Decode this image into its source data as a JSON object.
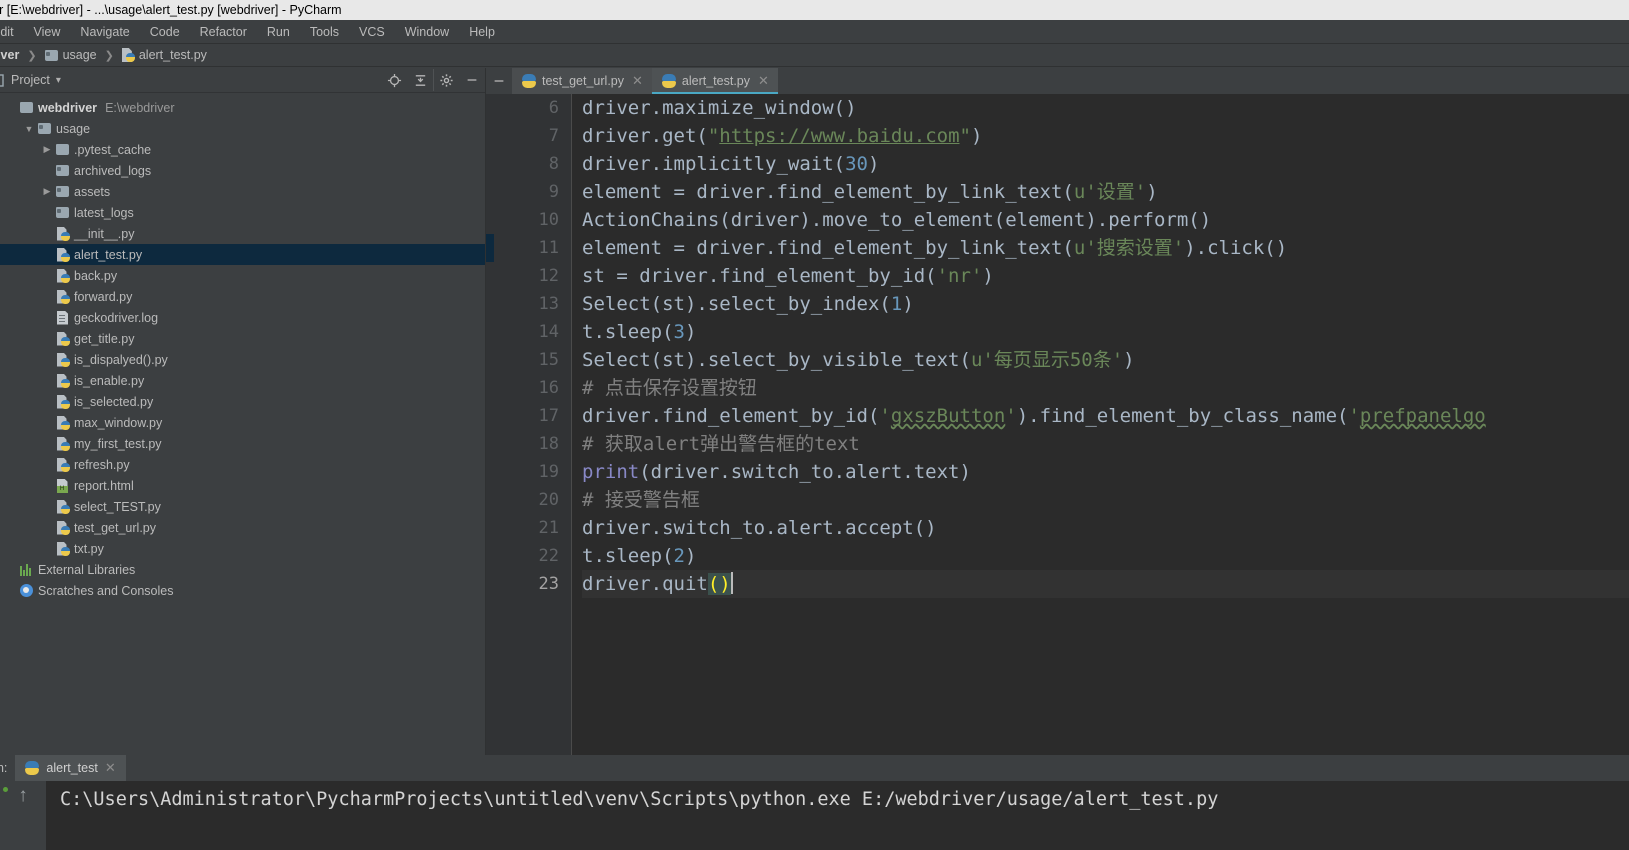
{
  "window": {
    "title": "driver [E:\\webdriver] - ...\\usage\\alert_test.py [webdriver] - PyCharm"
  },
  "menubar": {
    "items": [
      "Edit",
      "View",
      "Navigate",
      "Code",
      "Refactor",
      "Run",
      "Tools",
      "VCS",
      "Window",
      "Help"
    ]
  },
  "breadcrumb": {
    "items": [
      "ebdriver",
      "usage",
      "alert_test.py"
    ]
  },
  "project_panel": {
    "title": "Project",
    "chevron": "▾",
    "tools": [
      "locate-icon",
      "collapse-all-icon",
      "settings-icon",
      "hide-icon"
    ],
    "tree": [
      {
        "label": "webdriver",
        "sub": "E:\\webdriver",
        "icon": "folder-icon",
        "arrow": "",
        "indent": 0,
        "selected": false,
        "root": true
      },
      {
        "label": "usage",
        "sub": "",
        "icon": "module-folder-icon",
        "arrow": "▼",
        "indent": 1,
        "selected": false,
        "root": false
      },
      {
        "label": ".pytest_cache",
        "sub": "",
        "icon": "folder-icon",
        "arrow": "▶",
        "indent": 2,
        "selected": false,
        "root": false
      },
      {
        "label": "archived_logs",
        "sub": "",
        "icon": "module-folder-icon",
        "arrow": "",
        "indent": 2,
        "selected": false,
        "root": false
      },
      {
        "label": "assets",
        "sub": "",
        "icon": "module-folder-icon",
        "arrow": "▶",
        "indent": 2,
        "selected": false,
        "root": false
      },
      {
        "label": "latest_logs",
        "sub": "",
        "icon": "module-folder-icon",
        "arrow": "",
        "indent": 2,
        "selected": false,
        "root": false
      },
      {
        "label": "__init__.py",
        "sub": "",
        "icon": "python-file-icon",
        "arrow": "",
        "indent": 2,
        "selected": false,
        "root": false
      },
      {
        "label": "alert_test.py",
        "sub": "",
        "icon": "python-file-icon",
        "arrow": "",
        "indent": 2,
        "selected": true,
        "root": false
      },
      {
        "label": "back.py",
        "sub": "",
        "icon": "python-file-icon",
        "arrow": "",
        "indent": 2,
        "selected": false,
        "root": false
      },
      {
        "label": "forward.py",
        "sub": "",
        "icon": "python-file-icon",
        "arrow": "",
        "indent": 2,
        "selected": false,
        "root": false
      },
      {
        "label": "geckodriver.log",
        "sub": "",
        "icon": "log-file-icon",
        "arrow": "",
        "indent": 2,
        "selected": false,
        "root": false
      },
      {
        "label": "get_title.py",
        "sub": "",
        "icon": "python-file-icon",
        "arrow": "",
        "indent": 2,
        "selected": false,
        "root": false
      },
      {
        "label": "is_dispalyed().py",
        "sub": "",
        "icon": "python-file-icon",
        "arrow": "",
        "indent": 2,
        "selected": false,
        "root": false
      },
      {
        "label": "is_enable.py",
        "sub": "",
        "icon": "python-file-icon",
        "arrow": "",
        "indent": 2,
        "selected": false,
        "root": false
      },
      {
        "label": "is_selected.py",
        "sub": "",
        "icon": "python-file-icon",
        "arrow": "",
        "indent": 2,
        "selected": false,
        "root": false
      },
      {
        "label": "max_window.py",
        "sub": "",
        "icon": "python-file-icon",
        "arrow": "",
        "indent": 2,
        "selected": false,
        "root": false
      },
      {
        "label": "my_first_test.py",
        "sub": "",
        "icon": "python-file-icon",
        "arrow": "",
        "indent": 2,
        "selected": false,
        "root": false
      },
      {
        "label": "refresh.py",
        "sub": "",
        "icon": "python-file-icon",
        "arrow": "",
        "indent": 2,
        "selected": false,
        "root": false
      },
      {
        "label": "report.html",
        "sub": "",
        "icon": "html-file-icon",
        "arrow": "",
        "indent": 2,
        "selected": false,
        "root": false
      },
      {
        "label": "select_TEST.py",
        "sub": "",
        "icon": "python-file-icon",
        "arrow": "",
        "indent": 2,
        "selected": false,
        "root": false
      },
      {
        "label": "test_get_url.py",
        "sub": "",
        "icon": "python-file-icon",
        "arrow": "",
        "indent": 2,
        "selected": false,
        "root": false
      },
      {
        "label": "txt.py",
        "sub": "",
        "icon": "python-file-icon",
        "arrow": "",
        "indent": 2,
        "selected": false,
        "root": false
      },
      {
        "label": "External Libraries",
        "sub": "",
        "icon": "libraries-icon",
        "arrow": "",
        "indent": 0,
        "selected": false,
        "root": false
      },
      {
        "label": "Scratches and Consoles",
        "sub": "",
        "icon": "scratches-icon",
        "arrow": "",
        "indent": 0,
        "selected": false,
        "root": false
      }
    ]
  },
  "editor": {
    "tabs": [
      {
        "label": "test_get_url.py",
        "active": false,
        "close": "✕"
      },
      {
        "label": "alert_test.py",
        "active": true,
        "close": "✕"
      }
    ],
    "first_line_number": 6,
    "line_numbers": [
      "6",
      "7",
      "8",
      "9",
      "10",
      "11",
      "12",
      "13",
      "14",
      "15",
      "16",
      "17",
      "18",
      "19",
      "20",
      "21",
      "22",
      "23"
    ],
    "lines": [
      "driver.maximize_window()",
      "driver.get(\"https://www.baidu.com\")",
      "driver.implicitly_wait(30)",
      "element = driver.find_element_by_link_text(u'设置')",
      "ActionChains(driver).move_to_element(element).perform()",
      "element = driver.find_element_by_link_text(u'搜索设置').click()",
      "st = driver.find_element_by_id('nr')",
      "Select(st).select_by_index(1)",
      "t.sleep(3)",
      "Select(st).select_by_visible_text(u'每页显示50条')",
      "# 点击保存设置按钮",
      "driver.find_element_by_id('gxszButton').find_element_by_class_name('prefpanelgo",
      "# 获取alert弹出警告框的text",
      "print(driver.switch_to.alert.text)",
      "# 接受警告框",
      "driver.switch_to.alert.accept()",
      "t.sleep(2)",
      "driver.quit()"
    ]
  },
  "run_panel": {
    "label": "un:",
    "tab_label": "alert_test",
    "tab_close": "✕",
    "rerun_icon": "rerun-icon",
    "scroll_up_icon": "↑",
    "console_output": "C:\\Users\\Administrator\\PycharmProjects\\untitled\\venv\\Scripts\\python.exe E:/webdriver/usage/alert_test.py"
  },
  "colors": {
    "panel_bg": "#3c3f41",
    "editor_bg": "#2b2b2b",
    "gutter_bg": "#313335",
    "selection_blue": "#0d293e",
    "accent_tab": "#4aa8c4",
    "string_green": "#6a8759",
    "number_blue": "#6897bb",
    "comment_gray": "#808080",
    "builtin_purple": "#8888c6",
    "default_text": "#a9b7c6"
  }
}
